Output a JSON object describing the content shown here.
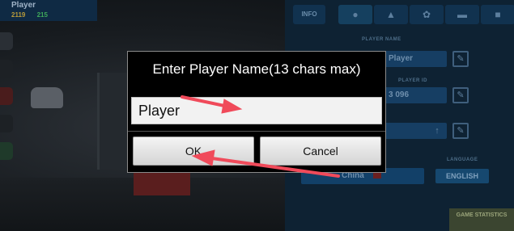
{
  "background": {
    "player_tag": "Player",
    "coins": "2119",
    "cash": "215"
  },
  "settings": {
    "tab_info": "INFO",
    "player_name_label": "PLAYER NAME",
    "player_name_value": "Player",
    "player_id_label": "PLAYER ID",
    "player_id_value": "3 096",
    "country_value": "China",
    "language_label": "LANGUAGE",
    "language_value": "ENGLISH",
    "stats_button": "GAME STATISTICS"
  },
  "dialog": {
    "title": "Enter Player Name(13 chars max)",
    "input_value": "Player",
    "ok_label": "OK",
    "cancel_label": "Cancel"
  },
  "colors": {
    "dialog_bg": "#000000",
    "arrow": "#f04a5a",
    "panel": "#0e2233"
  }
}
